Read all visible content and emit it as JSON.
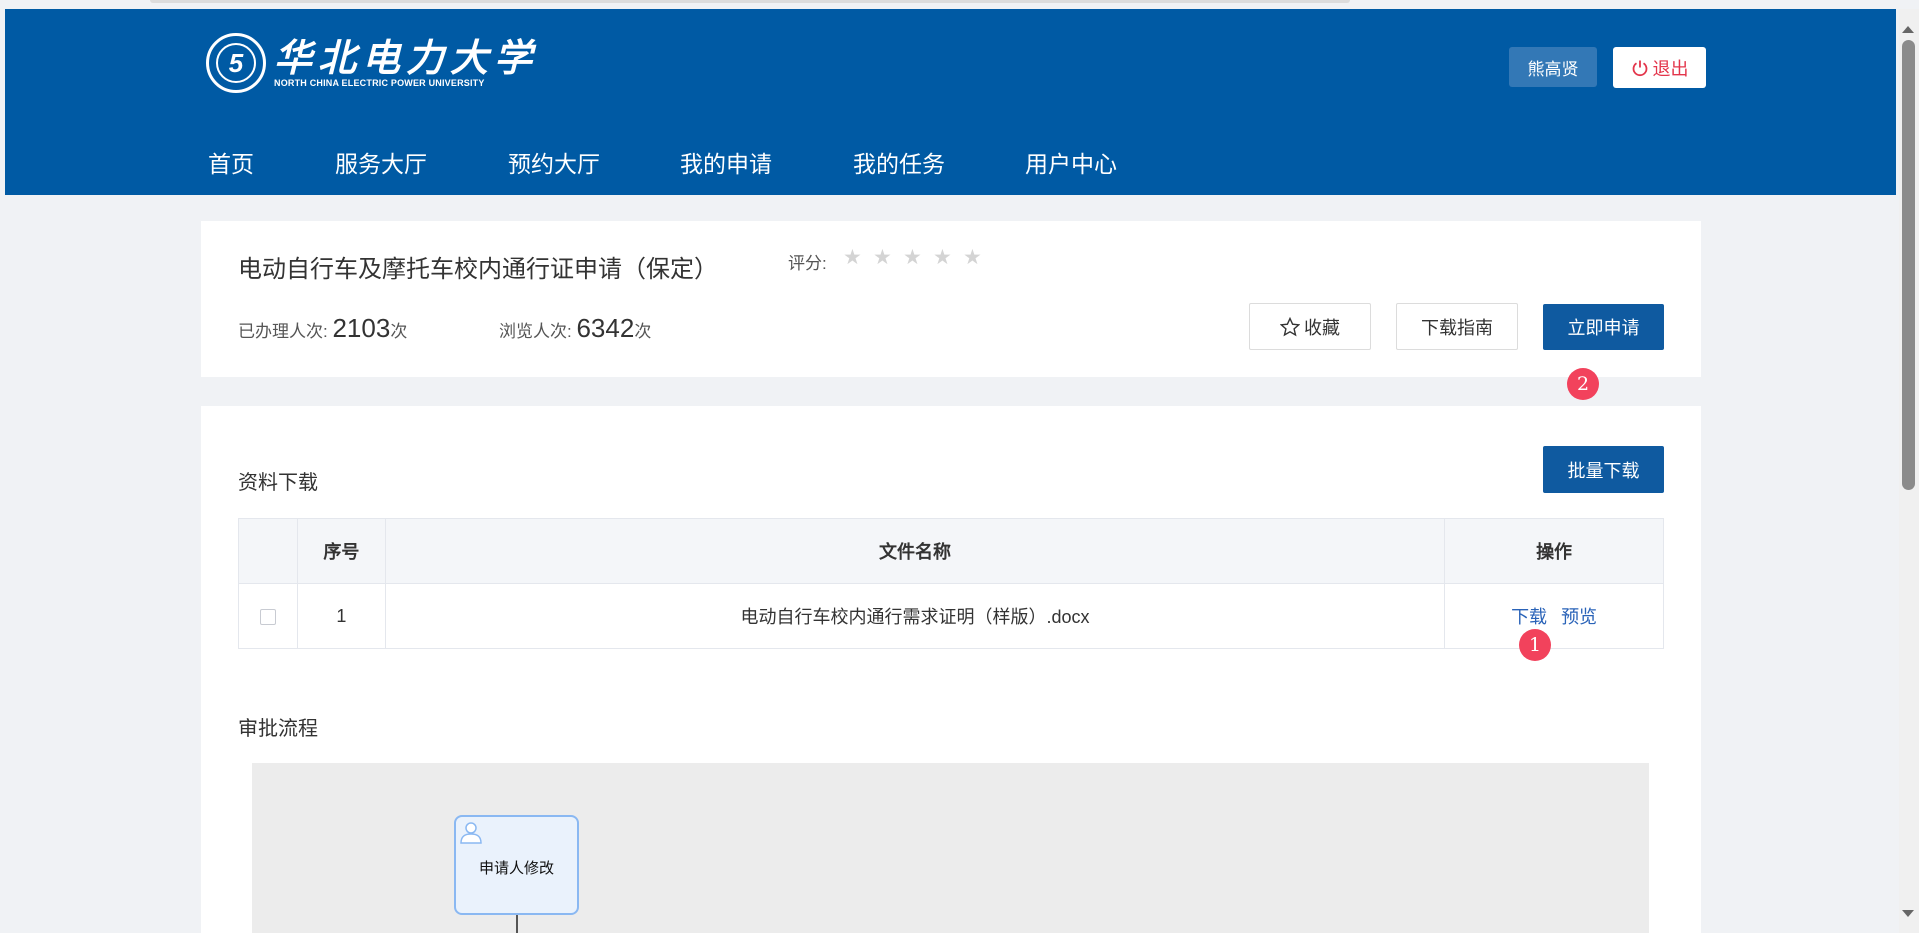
{
  "header": {
    "logo_cn": "华北电力大学",
    "logo_en": "NORTH CHINA ELECTRIC POWER UNIVERSITY",
    "user_name": "熊高贤",
    "logout_label": "退出",
    "nav": [
      {
        "label": "首页"
      },
      {
        "label": "服务大厅"
      },
      {
        "label": "预约大厅"
      },
      {
        "label": "我的申请"
      },
      {
        "label": "我的任务"
      },
      {
        "label": "用户中心"
      }
    ]
  },
  "service": {
    "title": "电动自行车及摩托车校内通行证申请（保定）",
    "rating_label": "评分:",
    "rating_value": 0,
    "rating_max": 5,
    "handled_label": "已办理人次:",
    "handled_count": "2103",
    "handled_unit": "次",
    "viewed_label": "浏览人次:",
    "viewed_count": "6342",
    "viewed_unit": "次",
    "favorite_label": "收藏",
    "guide_label": "下载指南",
    "apply_label": "立即申请",
    "apply_badge": "2"
  },
  "downloads": {
    "section_title": "资料下载",
    "batch_label": "批量下载",
    "columns": [
      "序号",
      "文件名称",
      "操作"
    ],
    "rows": [
      {
        "index": "1",
        "filename": "电动自行车校内通行需求证明（样版）.docx",
        "download": "下载",
        "preview": "预览"
      }
    ],
    "download_badge": "1"
  },
  "process": {
    "section_title": "审批流程",
    "nodes": [
      {
        "label": "申请人修改"
      }
    ]
  },
  "colors": {
    "header_bg": "#005aa4",
    "primary": "#0f5aa0",
    "logout": "#e3354b",
    "badge": "#f2425c",
    "link": "#2a63b8"
  }
}
